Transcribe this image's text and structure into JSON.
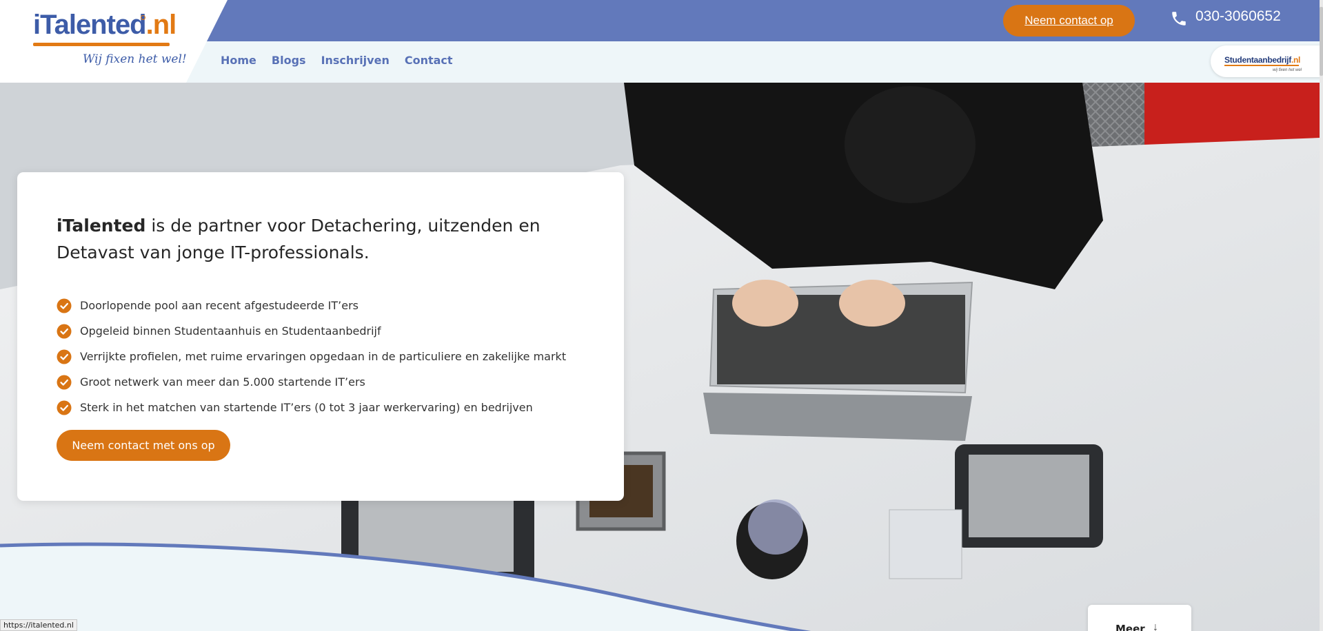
{
  "brand": {
    "logo_part1": "iTalented",
    "logo_part2": ".nl",
    "tagline": "Wij fixen het wel!",
    "partner_part1": "Studentaanbedrijf",
    "partner_part2": ".nl",
    "partner_tagline": "wij fixen het wel",
    "colors": {
      "primary_blue": "#6279bb",
      "accent_orange": "#d97514"
    }
  },
  "header": {
    "contact_button": "Neem contact op",
    "phone_icon": "phone-icon",
    "phone_number": "030-3060652"
  },
  "nav": {
    "items": [
      {
        "label": "Home"
      },
      {
        "label": "Blogs"
      },
      {
        "label": "Inschrijven"
      },
      {
        "label": "Contact"
      }
    ]
  },
  "hero": {
    "title_bold": "iTalented",
    "title_rest": " is de partner voor Detachering, uitzenden en Detavast van jonge IT-professionals.",
    "bullet_icon": "check-circle-icon",
    "bullets": [
      "Doorlopende pool aan recent afgestudeerde IT’ers",
      "Opgeleid binnen Studentaanhuis en Studentaanbedrijf",
      "Verrijkte profielen, met ruime ervaringen opgedaan in de particuliere en zakelijke markt",
      "Groot netwerk van meer dan 5.000 startende IT’ers",
      "Sterk in het matchen van startende IT’ers (0 tot 3 jaar werkervaring) en bedrijven"
    ],
    "cta_label": "Neem contact met ons op",
    "more_label": "Meer",
    "more_icon": "arrow-down-icon"
  },
  "status_bar": {
    "url": "https://italented.nl"
  }
}
